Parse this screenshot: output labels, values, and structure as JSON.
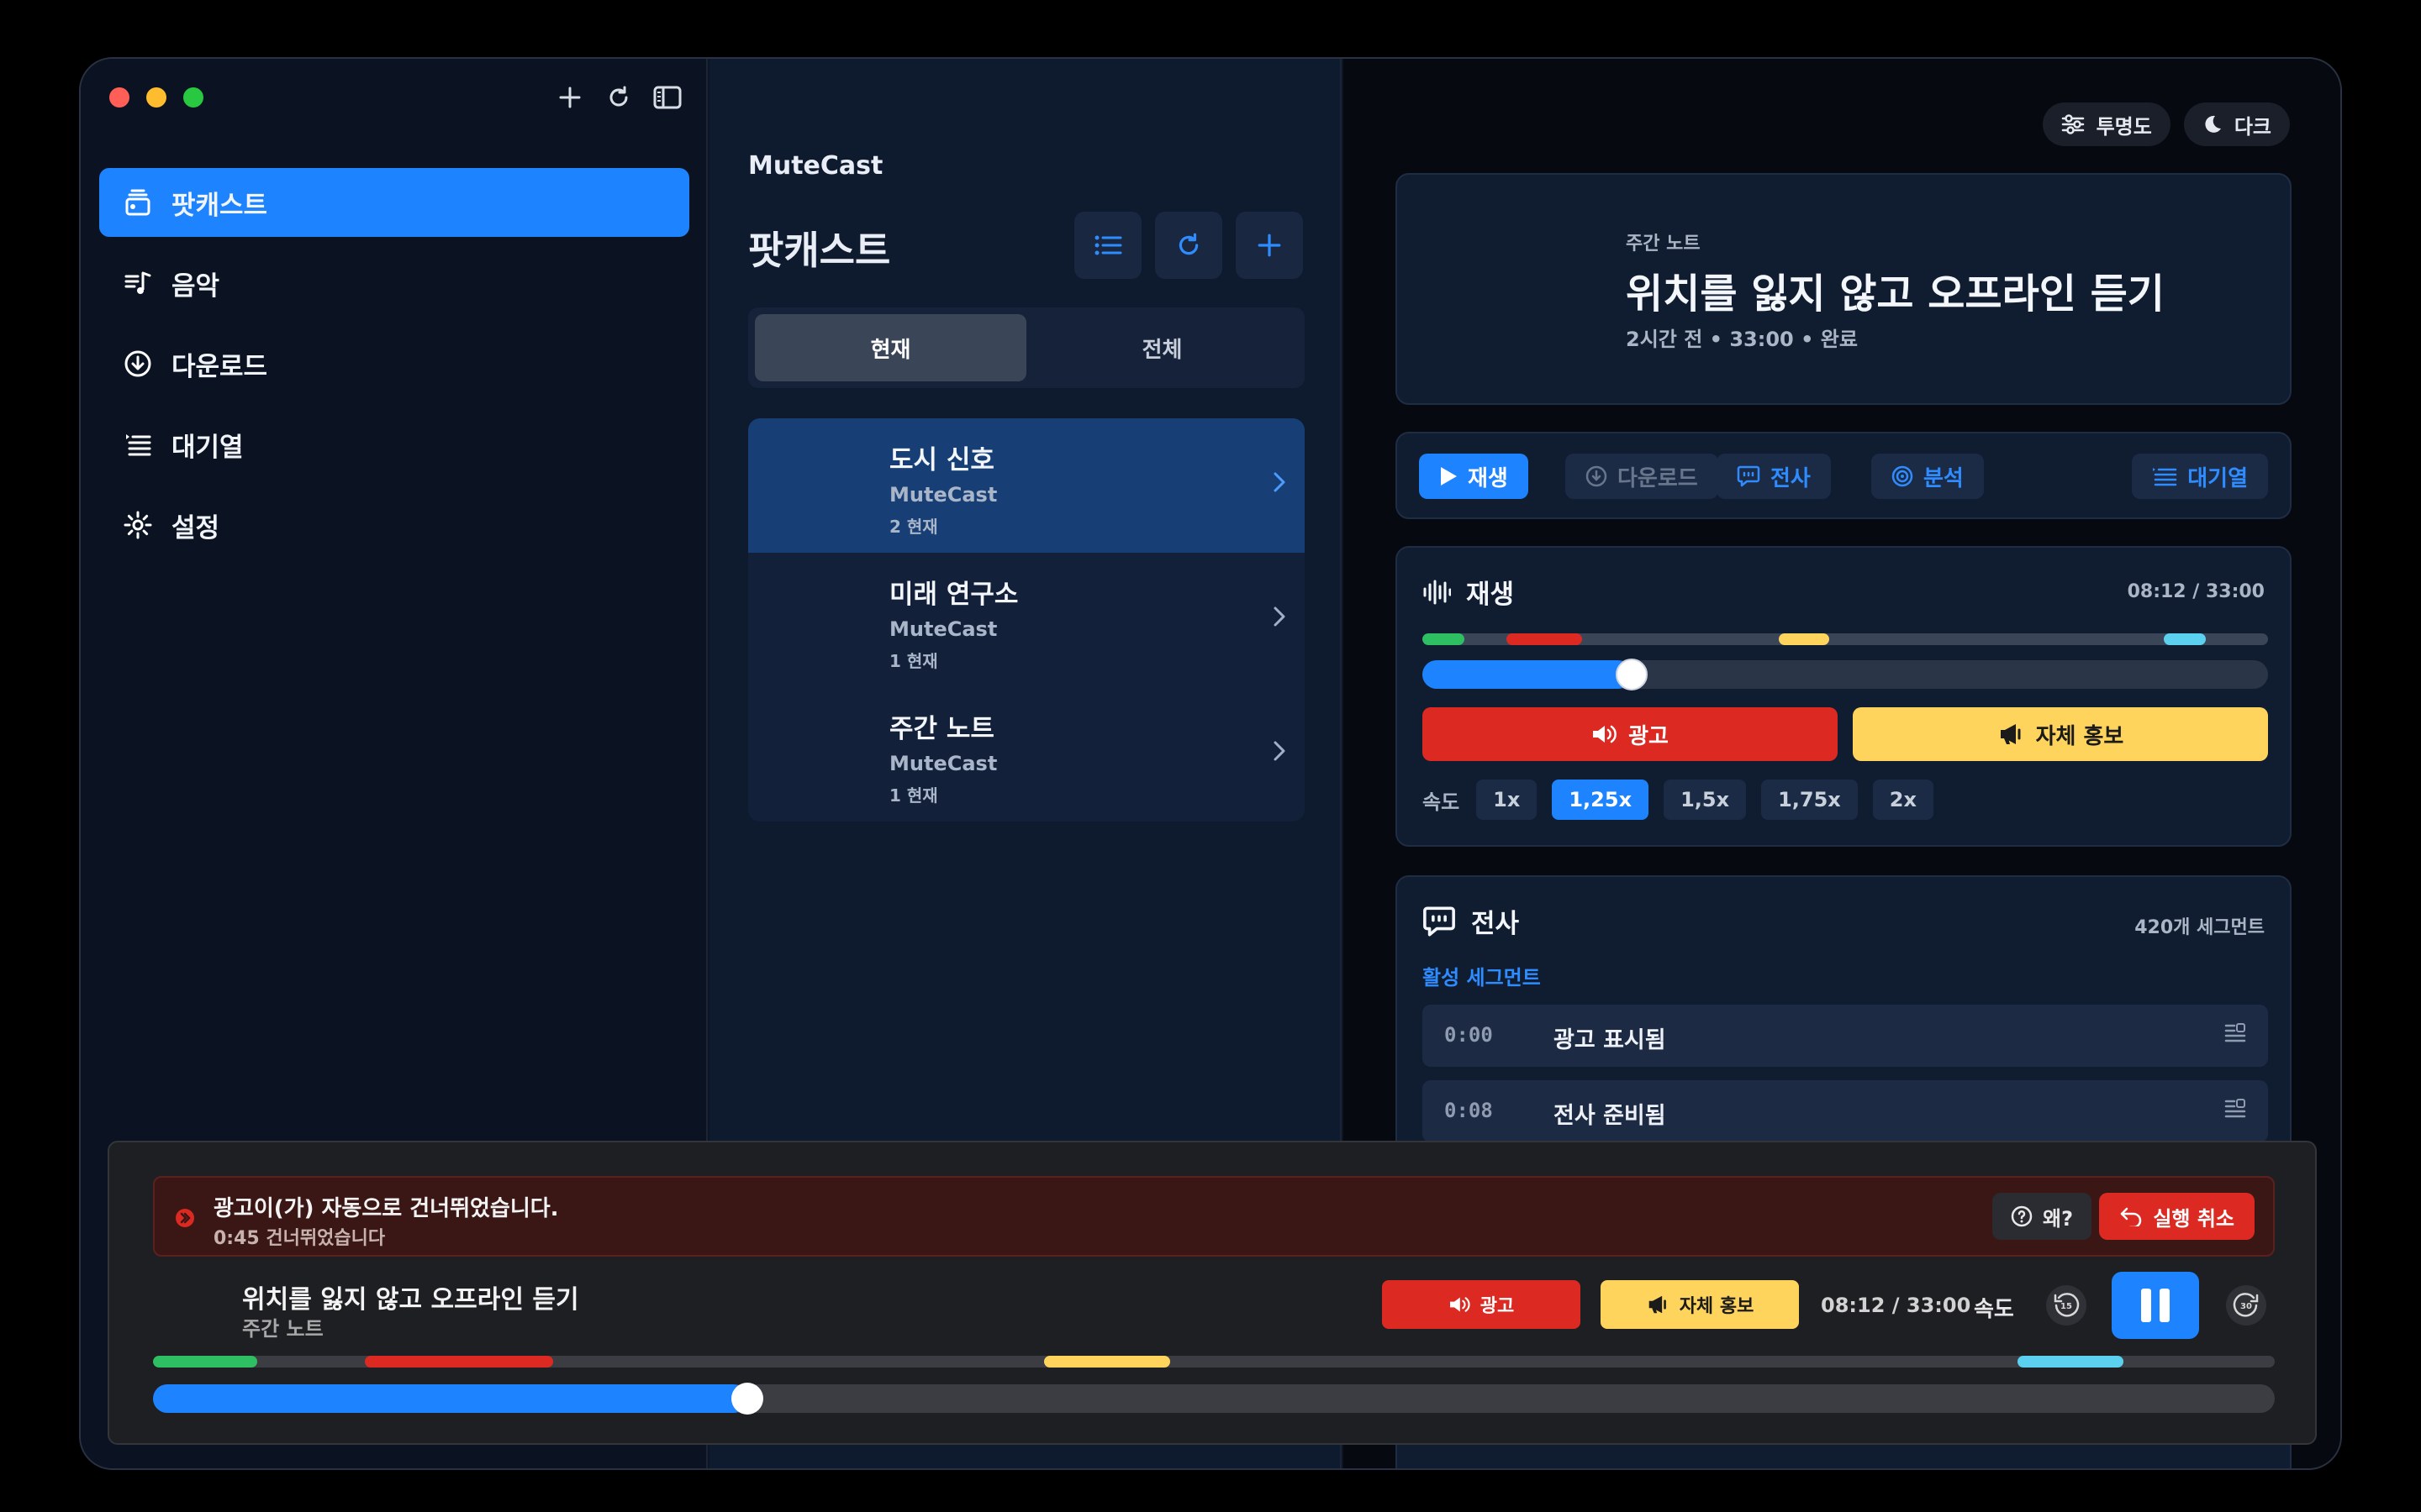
{
  "sidebar": {
    "items": [
      {
        "label": "팟캐스트",
        "icon": "podcast-stack-icon",
        "active": true
      },
      {
        "label": "음악",
        "icon": "music-note-icon",
        "active": false
      },
      {
        "label": "다운로드",
        "icon": "download-circle-icon",
        "active": false
      },
      {
        "label": "대기열",
        "icon": "queue-list-icon",
        "active": false
      },
      {
        "label": "설정",
        "icon": "gear-icon",
        "active": false
      }
    ]
  },
  "library": {
    "brand": "MuteCast",
    "title": "팟캐스트",
    "tabs": [
      "현재",
      "전체"
    ],
    "active_tab": "현재",
    "podcasts": [
      {
        "title": "도시 신호",
        "author": "MuteCast",
        "count": "2 현재"
      },
      {
        "title": "미래 연구소",
        "author": "MuteCast",
        "count": "1 현재"
      },
      {
        "title": "주간 노트",
        "author": "MuteCast",
        "count": "1 현재"
      }
    ]
  },
  "detail": {
    "opacity_label": "투명도",
    "theme_label": "다크",
    "kicker": "주간 노트",
    "title": "위치를 잃지 않고 오프라인 듣기",
    "meta": "2시간 전 • 33:00 • 완료",
    "actions": {
      "play": "재생",
      "download": "다운로드",
      "transcript": "전사",
      "analyze": "분석",
      "queue": "대기열"
    },
    "playback": {
      "title": "재생",
      "time": "08:12 / 33:00",
      "progress": 0.248,
      "ad_label": "광고",
      "promo_label": "자체 홍보",
      "speed_label": "속도",
      "speeds": [
        "1x",
        "1,25x",
        "1,5x",
        "1,75x",
        "2x"
      ],
      "active_speed": "1,25x"
    },
    "transcript": {
      "title": "전사",
      "count": "420개 세그먼트",
      "active_label": "활성 세그먼트",
      "segments": [
        {
          "time": "0:00",
          "text": "광고 표시됨"
        },
        {
          "time": "0:08",
          "text": "전사 준비됨"
        }
      ]
    }
  },
  "mini_player": {
    "banner_title": "광고이(가) 자동으로 건너뛰었습니다.",
    "banner_sub": "0:45 건너뛰었습니다",
    "why_label": "왜?",
    "undo_label": "실행 취소",
    "title": "위치를 잃지 않고 오프라인 듣기",
    "subtitle": "주간 노트",
    "ad_label": "광고",
    "promo_label": "자체 홍보",
    "time": "08:12 / 33:00",
    "speed_label": "속도",
    "skip_back": "15",
    "skip_forward": "30",
    "progress": 0.28
  },
  "colors": {
    "accent": "#1d83ff",
    "ad": "#dc2a22",
    "promo": "#ffd45c",
    "green_marker": "#2fbf63",
    "cyan_marker": "#5bd0ef"
  }
}
